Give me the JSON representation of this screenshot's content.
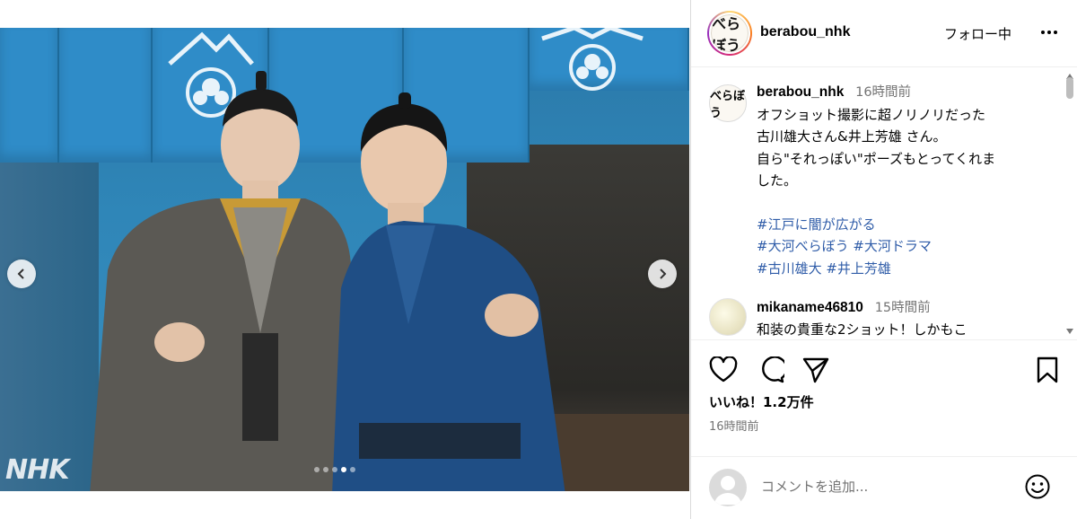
{
  "media": {
    "watermark": "NHK",
    "carousel": {
      "count": 5,
      "active_index": 3
    }
  },
  "header": {
    "username": "berabou_nhk",
    "follow_status": "フォロー中",
    "avatar_text": "べらぼう"
  },
  "caption": {
    "username": "berabou_nhk",
    "time": "16時間前",
    "lines": [
      "オフショット撮影に超ノリノリだった",
      "古川雄大さん&井上芳雄 さん。",
      "自ら\"それっぽい\"ポーズもとってくれま",
      "した。"
    ],
    "hashtag_lines": [
      "#江戸に闇が広がる",
      "#大河べらぼう #大河ドラマ",
      "#古川雄大 #井上芳雄"
    ]
  },
  "comment": {
    "username": "mikaname46810",
    "time": "15時間前",
    "text": "和装の貴重な2ショット！しかもこ"
  },
  "actions": {
    "likes": "いいね！1.2万件",
    "post_time": "16時間前"
  },
  "comment_box": {
    "placeholder": "コメントを追加..."
  },
  "colors": {
    "link": "#00376b",
    "muted": "#737373",
    "border": "#dbdbdb"
  }
}
